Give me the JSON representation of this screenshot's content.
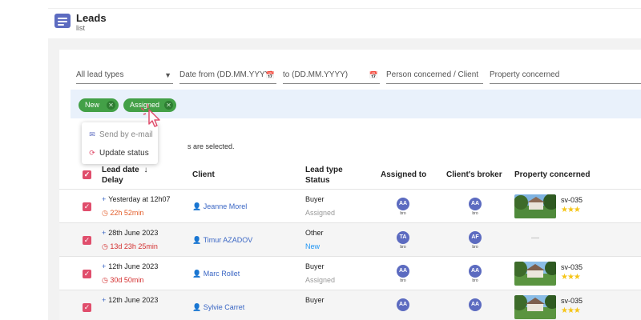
{
  "header": {
    "title": "Leads",
    "subtitle": "list"
  },
  "filters": {
    "lead_types": "All lead types",
    "date_from": "Date from (DD.MM.YYYY)",
    "date_to": "to (DD.MM.YYYY)",
    "person": "Person concerned / Client",
    "property": "Property concerned"
  },
  "chips": [
    {
      "label": "New"
    },
    {
      "label": "Assigned"
    }
  ],
  "selection_text": "s are selected.",
  "menu": {
    "send_email": "Send by e-mail",
    "update_status": "Update status"
  },
  "columns": {
    "lead_date": "Lead date",
    "sort_arrow": "↓",
    "delay": "Delay",
    "client": "Client",
    "lead_type": "Lead type",
    "status": "Status",
    "assigned_to": "Assigned to",
    "brokers": "Client's broker",
    "property": "Property concerned"
  },
  "rows": [
    {
      "date": "Yesterday at 12h07",
      "delay": "22h 52min",
      "client": "Jeanne Morel",
      "type": "Buyer",
      "status": "Assigned",
      "assigned": {
        "initials": "AA",
        "sub": "bro"
      },
      "broker": {
        "initials": "AA",
        "sub": "bro"
      },
      "ref": "sv-035",
      "stars": "★★★"
    },
    {
      "date": "28th June 2023",
      "delay": "13d 23h 25min",
      "client": "Timur AZADOV",
      "type": "Other",
      "status": "New",
      "assigned": {
        "initials": "TA",
        "sub": "bro"
      },
      "broker": {
        "initials": "AF",
        "sub": "bro"
      },
      "ref": "",
      "stars": "",
      "empty_property": "—"
    },
    {
      "date": "12th June 2023",
      "delay": "30d 50min",
      "client": "Marc Rollet",
      "type": "Buyer",
      "status": "Assigned",
      "assigned": {
        "initials": "AA",
        "sub": "bro"
      },
      "broker": {
        "initials": "AA",
        "sub": "bro"
      },
      "ref": "sv-035",
      "stars": "★★★"
    },
    {
      "date": "12th June 2023",
      "delay": "",
      "client": "Sylvie Carret",
      "type": "Buyer",
      "status": "",
      "assigned": {
        "initials": "AA",
        "sub": ""
      },
      "broker": {
        "initials": "AA",
        "sub": ""
      },
      "ref": "sv-035",
      "stars": "★★★"
    }
  ],
  "colors": {
    "accent": "#5c6bc0",
    "chip": "#43a047",
    "checkbox": "#e04e6c",
    "link": "#3a66c4",
    "delay": "#e35d2a"
  }
}
